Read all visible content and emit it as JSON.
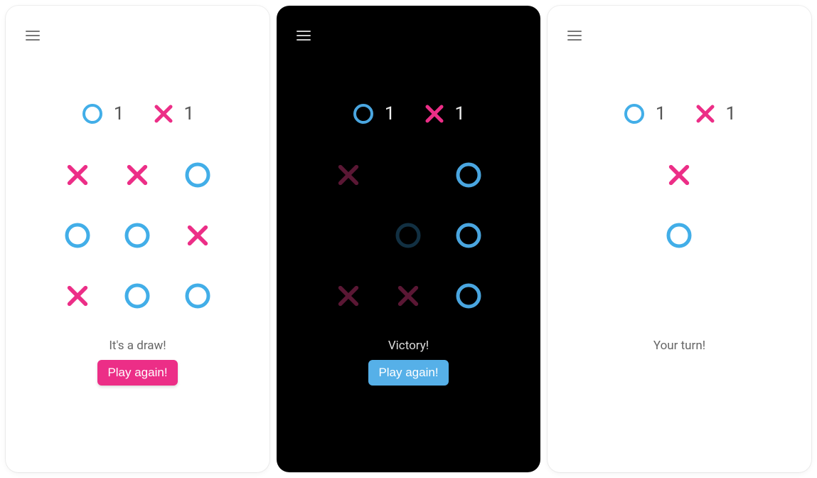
{
  "colors": {
    "o_light": "#42aee8",
    "x_light": "#ec2e87",
    "o_dark": "#4aa6e0",
    "x_dark_dim": "#5a1734",
    "o_dark_dim": "#123042"
  },
  "screens": [
    {
      "id": "draw",
      "theme": "light",
      "score_o": "1",
      "score_x": "1",
      "board": [
        "X",
        "X",
        "O",
        "O",
        "O",
        "X",
        "X",
        "O",
        "O"
      ],
      "status": "It's a draw!",
      "button": "Play again!",
      "button_style": "pink",
      "interactable_cells": false
    },
    {
      "id": "victory",
      "theme": "dark",
      "score_o": "1",
      "score_x": "1",
      "board": [
        "Xd",
        "",
        "O",
        "",
        "Od",
        "O",
        "Xd",
        "Xd",
        "O"
      ],
      "status": "Victory!",
      "button": "Play again!",
      "button_style": "blue",
      "interactable_cells": false
    },
    {
      "id": "your-turn",
      "theme": "light",
      "score_o": "1",
      "score_x": "1",
      "board": [
        "",
        "X",
        "",
        "",
        "O",
        "",
        "",
        "",
        ""
      ],
      "status": "Your turn!",
      "button": "",
      "button_style": "",
      "interactable_cells": true
    }
  ]
}
